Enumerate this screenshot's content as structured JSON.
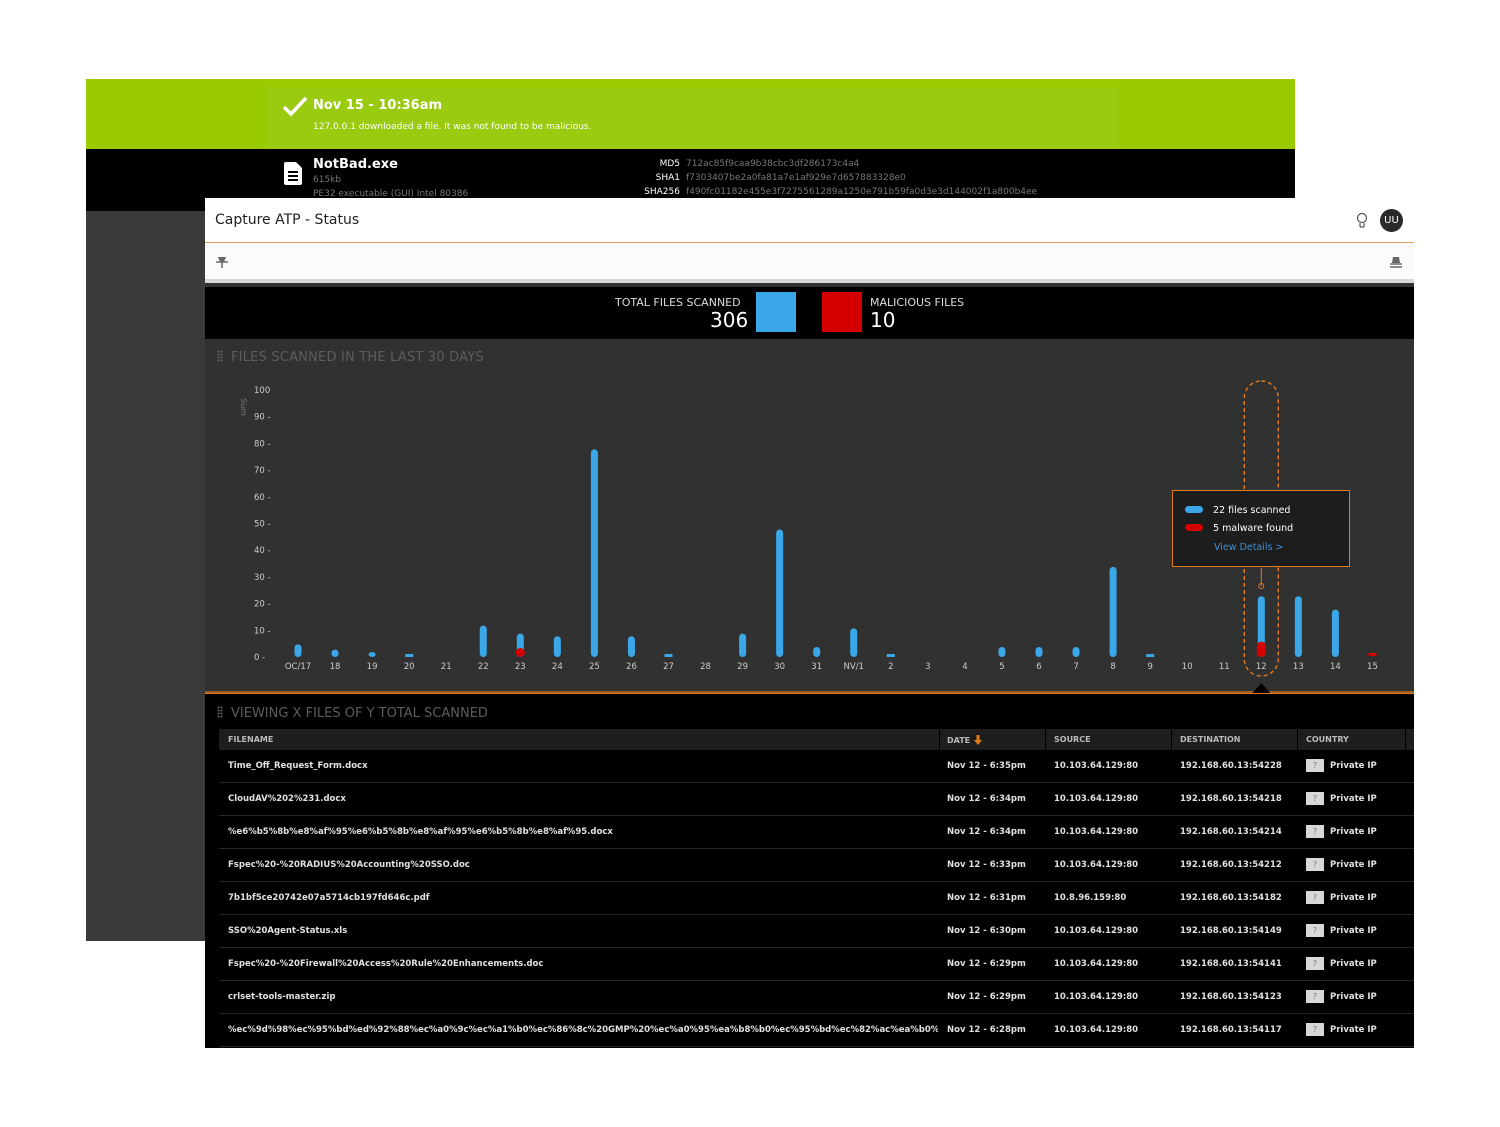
{
  "back_window": {
    "banner_title": "Nov 15 - 10:36am",
    "banner_message": "127.0.0.1 downloaded a file. It was not found to be malicious.",
    "file_name": "NotBad.exe",
    "file_size": "615kb",
    "file_type": "PE32 executable (GUI) Intel 80386",
    "hashes": [
      {
        "label": "MD5",
        "value": "712ac85f9caa9b38cbc3df286173c4a4"
      },
      {
        "label": "SHA1",
        "value": "f7303407be2a0fa81a7e1af929e7d657883328e0"
      },
      {
        "label": "SHA256",
        "value": "f490fc01182e455e3f7275561289a1250e791b59fa0d3e3d144002f1a800b4ee"
      }
    ],
    "colors": {
      "banner": "#9aca00"
    }
  },
  "app": {
    "title": "Capture ATP - Status",
    "avatar_initials": "UU",
    "icons": [
      "lightbulb-icon",
      "pin-icon",
      "unpin-icon"
    ]
  },
  "summary": {
    "total_label": "TOTAL FILES SCANNED",
    "total_value": "306",
    "malicious_label": "MALICIOUS FILES",
    "malicious_value": "10",
    "colors": {
      "scanned": "#3aa8e8",
      "malicious": "#d40000"
    }
  },
  "chart": {
    "header": "FILES SCANNED IN THE LAST 30 DAYS",
    "tooltip": {
      "scanned_text": "22 files scanned",
      "malware_text": "5 malware found",
      "link": "View Details >"
    }
  },
  "chart_data": {
    "type": "bar",
    "ylabel": "Sum",
    "ylim": [
      0,
      100
    ],
    "yticks": [
      "100",
      "90 -",
      "80 -",
      "70 -",
      "60 -",
      "50 -",
      "40 -",
      "30 -",
      "20 -",
      "10 -",
      "0 -"
    ],
    "categories": [
      "OC/17",
      "18",
      "19",
      "20",
      "21",
      "22",
      "23",
      "24",
      "25",
      "26",
      "27",
      "28",
      "29",
      "30",
      "31",
      "NV/1",
      "2",
      "3",
      "4",
      "5",
      "6",
      "7",
      "8",
      "9",
      "10",
      "11",
      "12",
      "13",
      "14",
      "15"
    ],
    "series": [
      {
        "name": "files scanned",
        "color": "#3aa8e8",
        "values": [
          4,
          2,
          1,
          0.5,
          0,
          11,
          8,
          7,
          77,
          7,
          0.5,
          0,
          8,
          47,
          3,
          10,
          0.5,
          0,
          0,
          3,
          3,
          3,
          33,
          0.5,
          0,
          0,
          22,
          22,
          17,
          0
        ]
      },
      {
        "name": "malware found",
        "color": "#d40000",
        "values": [
          0,
          0,
          0,
          0,
          0,
          0,
          2,
          0,
          0,
          0,
          0,
          0,
          0,
          0,
          0,
          0,
          0,
          0,
          0,
          0,
          0,
          0,
          0,
          0,
          0,
          0,
          5,
          0,
          0,
          0.5
        ]
      }
    ],
    "highlighted_category": "12",
    "grid": false
  },
  "table": {
    "header": "VIEWING X FILES OF Y TOTAL SCANNED",
    "columns": [
      "FILENAME",
      "DATE",
      "SOURCE",
      "DESTINATION",
      "COUNTRY"
    ],
    "rows": [
      {
        "filename": "Time_Off_Request_Form.docx",
        "date": "Nov 12 - 6:35pm",
        "source": "10.103.64.129:80",
        "destination": "192.168.60.13:54228",
        "country": "Private IP",
        "flag": "?"
      },
      {
        "filename": "CloudAV%202%231.docx",
        "date": "Nov 12 - 6:34pm",
        "source": "10.103.64.129:80",
        "destination": "192.168.60.13:54218",
        "country": "Private IP",
        "flag": "?"
      },
      {
        "filename": "%e6%b5%8b%e8%af%95%e6%b5%8b%e8%af%95%e6%b5%8b%e8%af%95.docx",
        "date": "Nov 12 - 6:34pm",
        "source": "10.103.64.129:80",
        "destination": "192.168.60.13:54214",
        "country": "Private IP",
        "flag": "?"
      },
      {
        "filename": "Fspec%20-%20RADIUS%20Accounting%20SSO.doc",
        "date": "Nov 12 - 6:33pm",
        "source": "10.103.64.129:80",
        "destination": "192.168.60.13:54212",
        "country": "Private IP",
        "flag": "?"
      },
      {
        "filename": "7b1bf5ce20742e07a5714cb197fd646c.pdf",
        "date": "Nov 12 - 6:31pm",
        "source": "10.8.96.159:80",
        "destination": "192.168.60.13:54182",
        "country": "Private IP",
        "flag": "?"
      },
      {
        "filename": "SSO%20Agent-Status.xls",
        "date": "Nov 12 - 6:30pm",
        "source": "10.103.64.129:80",
        "destination": "192.168.60.13:54149",
        "country": "Private IP",
        "flag": "?"
      },
      {
        "filename": "Fspec%20-%20Firewall%20Access%20Rule%20Enhancements.doc",
        "date": "Nov 12 - 6:29pm",
        "source": "10.103.64.129:80",
        "destination": "192.168.60.13:54141",
        "country": "Private IP",
        "flag": "?"
      },
      {
        "filename": "crlset-tools-master.zip",
        "date": "Nov 12 - 6:29pm",
        "source": "10.103.64.129:80",
        "destination": "192.168.60.13:54123",
        "country": "Private IP",
        "flag": "?"
      },
      {
        "filename": "%ec%9d%98%ec%95%bd%ed%92%88%ec%a0%9c%ec%a1%b0%ec%86%8c%20GMP%20%ec%a0%95%ea%b8%b0%ec%95%bd%ec%82%ac%ea%b0%90%ec%",
        "date": "Nov 12 - 6:28pm",
        "source": "10.103.64.129:80",
        "destination": "192.168.60.13:54117",
        "country": "Private IP",
        "flag": "?"
      }
    ]
  }
}
